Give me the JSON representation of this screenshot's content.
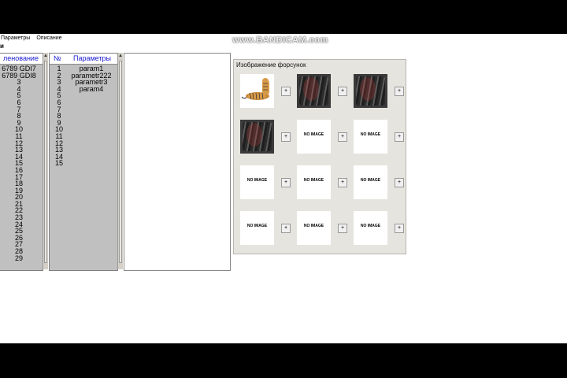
{
  "menu": [
    "Параметры",
    "Описание"
  ],
  "subtitle": "и",
  "watermark": "www.BANDICAM.com",
  "list1": {
    "header": "ленование",
    "rows": [
      "6789  GDI7",
      "6789  GDI8",
      "3",
      "4",
      "5",
      "6",
      "7",
      "8",
      "9",
      "10",
      "11",
      "12",
      "13",
      "14",
      "15",
      "16",
      "17",
      "18",
      "19",
      "20",
      "21",
      "22",
      "23",
      "24",
      "25",
      "26",
      "27",
      "28",
      "29"
    ]
  },
  "list2": {
    "header_num": "№",
    "header_params": "Параметры",
    "nums": [
      "1",
      "2",
      "3",
      "4",
      "5",
      "6",
      "7",
      "8",
      "9",
      "10",
      "11",
      "12",
      "13",
      "14",
      "15"
    ],
    "params": [
      "param1",
      "parametr222",
      "parametr3",
      "param4"
    ]
  },
  "images_group": {
    "title": "Изображение форсунок",
    "add_label": "+",
    "slots": [
      "tiger",
      "photo",
      "photo",
      "photo",
      "no-image",
      "no-image",
      "no-image",
      "no-image",
      "no-image",
      "no-image",
      "no-image",
      "no-image"
    ],
    "no_image_text": "NO IMAGE"
  }
}
